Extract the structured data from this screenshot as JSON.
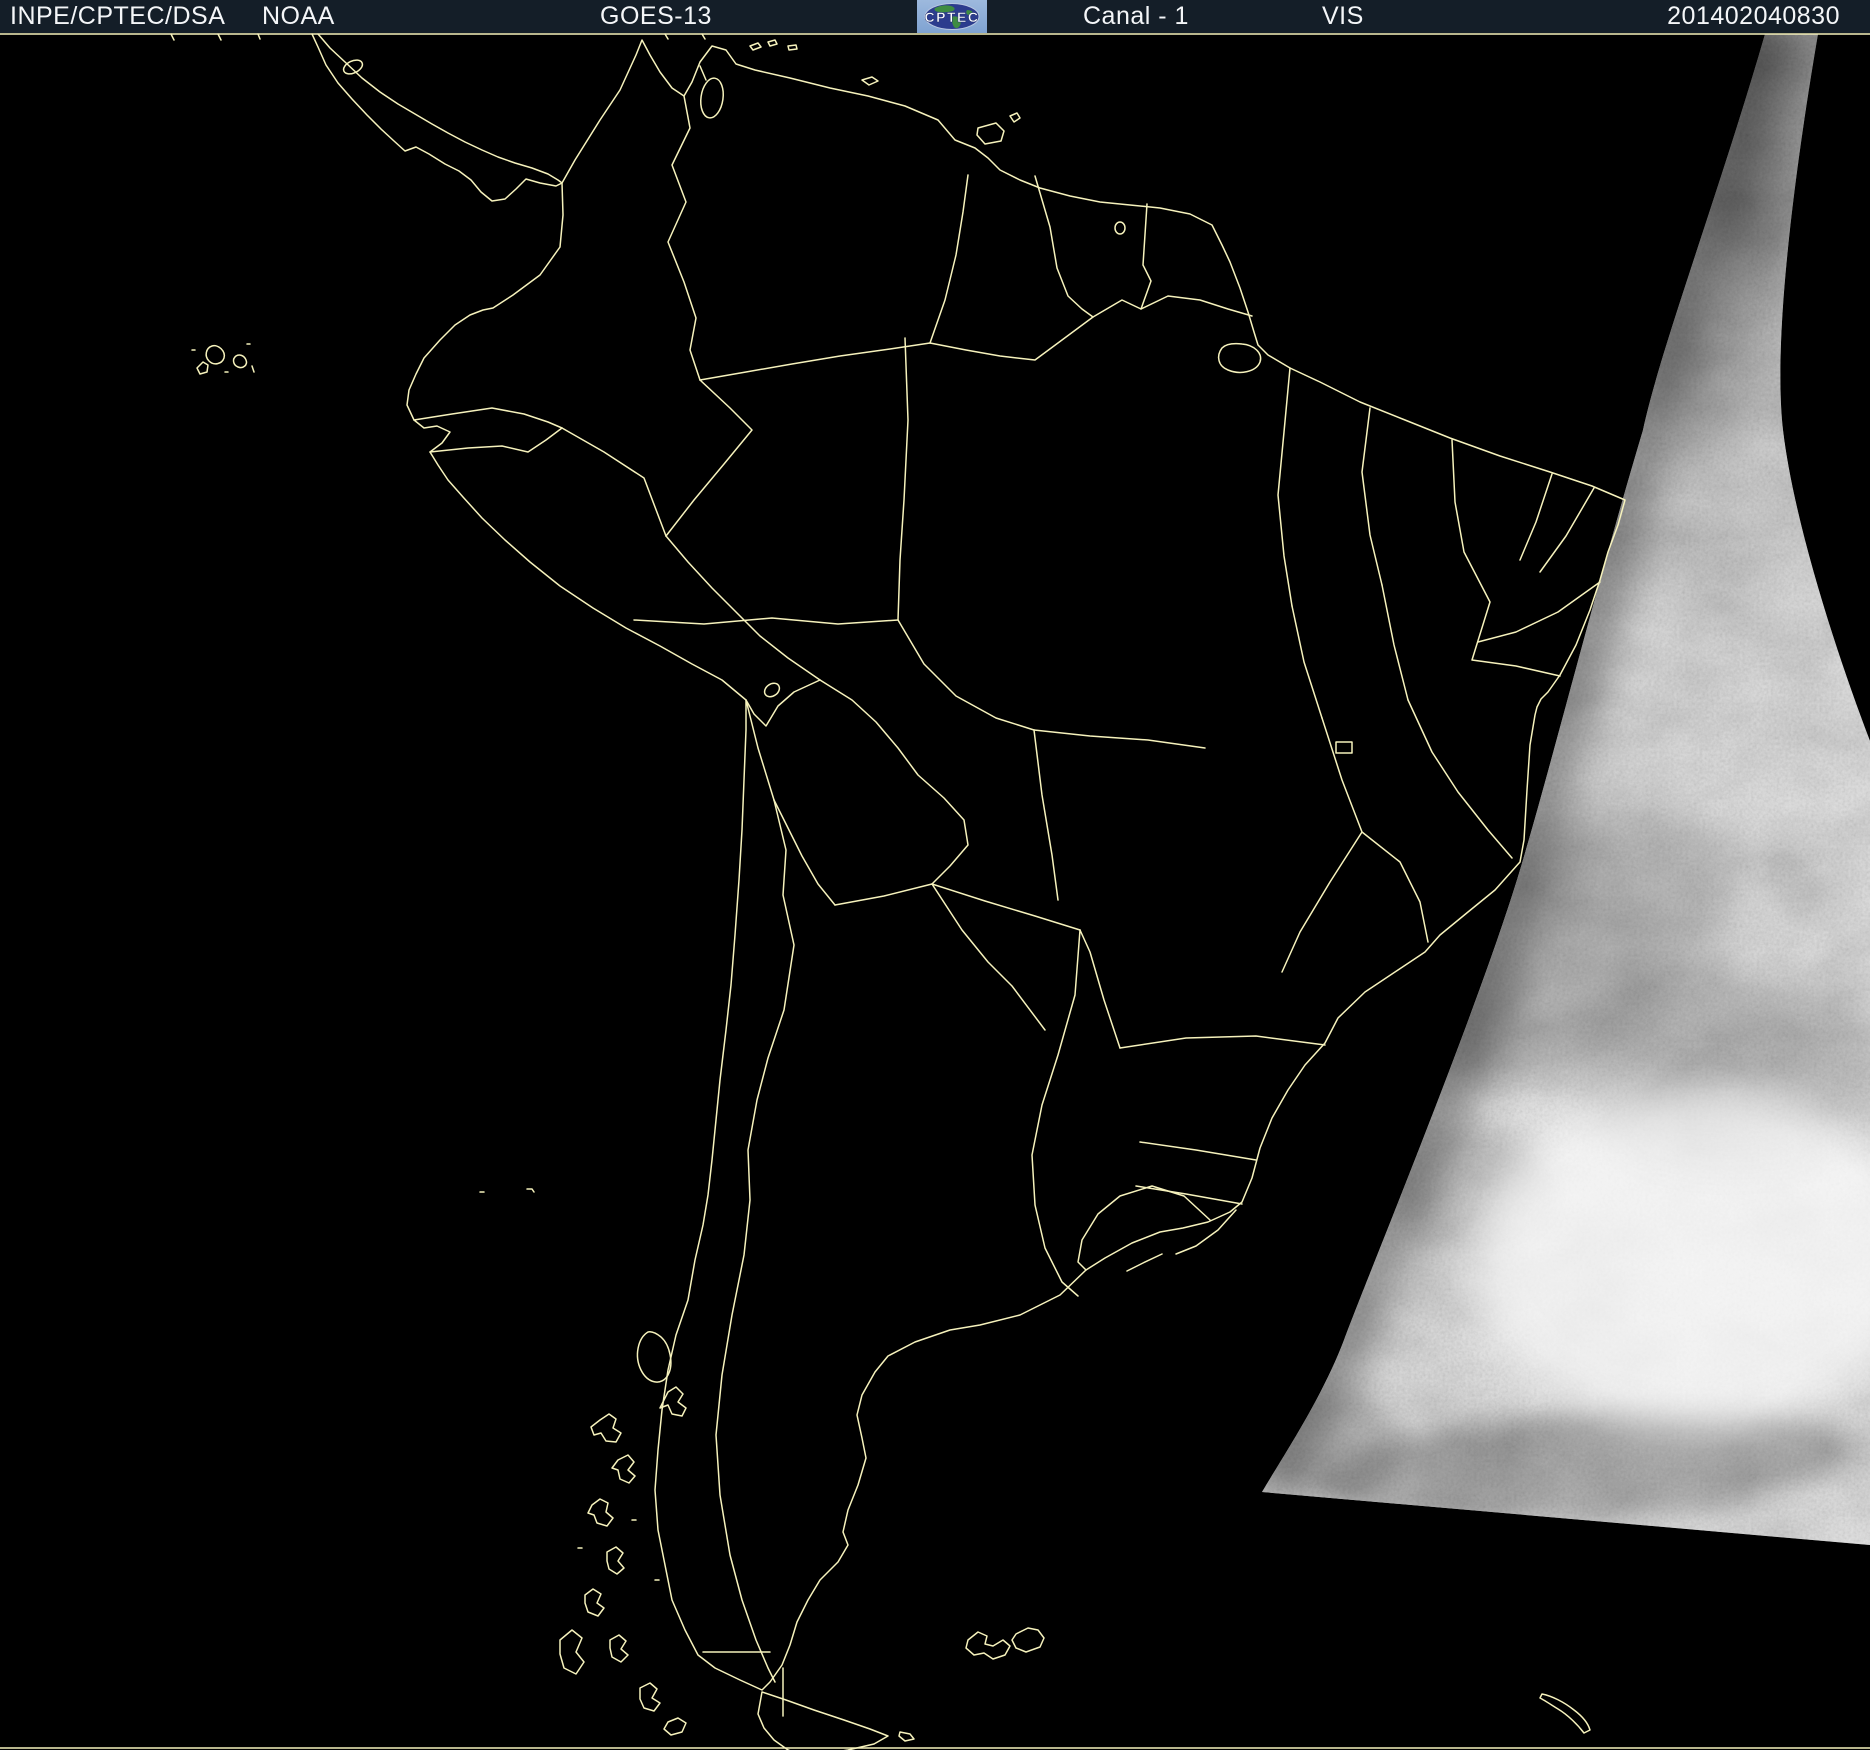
{
  "header": {
    "agency": "INPE/CPTEC/DSA",
    "organization": "NOAA",
    "satellite": "GOES-13",
    "logo_text": "CPTEC",
    "channel": "Canal - 1",
    "band": "VIS",
    "timestamp": "201402040830"
  },
  "colors": {
    "header_bg": "#141e28",
    "header_fg": "#f4f6f8",
    "map_background": "#000000",
    "map_outline": "#f6f2bc",
    "daylight_base": "#ededed",
    "daylight_shadow": "#8a8a8a",
    "logo_bg": "#8fb0d9",
    "logo_globe": "#2c3c8e",
    "logo_land": "#3e8c42"
  },
  "map": {
    "depicts": "GOES-13 visible channel satellite image of South America at night with sunlit dawn sector over the Atlantic",
    "outlined_features": [
      "South America coastline",
      "Central America",
      "country borders",
      "Brazilian state borders",
      "Galapagos Islands",
      "Trinidad",
      "Lake Maracaibo",
      "Lake Titicaca",
      "Marajo Island",
      "Chilean fjords",
      "Tierra del Fuego",
      "Falkland Islands",
      "South Georgia"
    ]
  }
}
